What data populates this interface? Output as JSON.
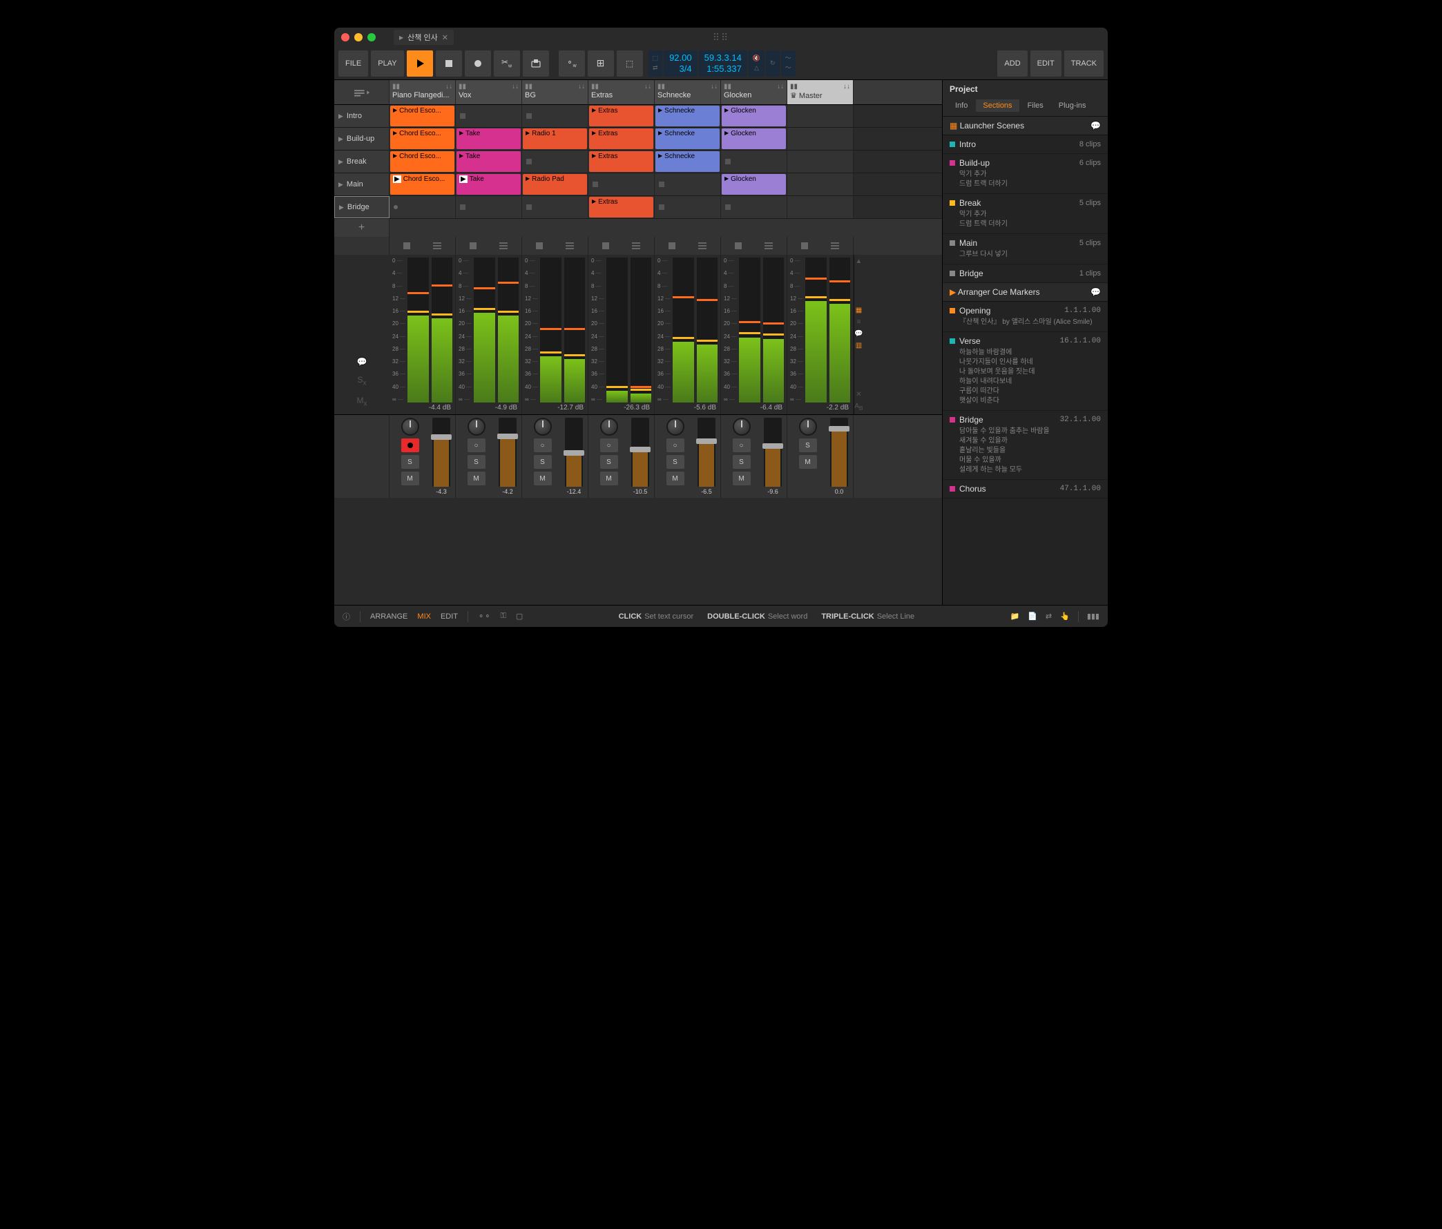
{
  "window": {
    "tab_title": "산책 인사"
  },
  "toolbar": {
    "file": "FILE",
    "play": "PLAY",
    "add": "ADD",
    "edit": "EDIT",
    "track": "TRACK",
    "tempo": "92.00",
    "timesig": "3/4",
    "position": "59.3.3.14",
    "time": "1:55.337"
  },
  "tracks": [
    {
      "name": "Piano Flangedi..."
    },
    {
      "name": "Vox"
    },
    {
      "name": "BG"
    },
    {
      "name": "Extras"
    },
    {
      "name": "Schnecke"
    },
    {
      "name": "Glocken"
    },
    {
      "name": "Master"
    }
  ],
  "scenes": [
    {
      "name": "Intro",
      "clips": [
        "Chord Esco...",
        null,
        null,
        "Extras",
        "Schnecke",
        "Glocken",
        null
      ]
    },
    {
      "name": "Build-up",
      "clips": [
        "Chord Esco...",
        "Take",
        "Radio 1",
        "Extras",
        "Schnecke",
        "Glocken",
        null
      ]
    },
    {
      "name": "Break",
      "clips": [
        "Chord Esco...",
        "Take",
        null,
        "Extras",
        "Schnecke",
        null,
        null
      ]
    },
    {
      "name": "Main",
      "clips": [
        "Chord Esco...",
        "Take",
        "Radio Pad",
        null,
        null,
        "Glocken",
        null
      ]
    },
    {
      "name": "Bridge",
      "clips": [
        null,
        null,
        null,
        "Extras",
        null,
        null,
        null
      ]
    }
  ],
  "clip_colors": {
    "Piano": "orange",
    "Vox": "magenta",
    "BG": "red",
    "Extras": "red",
    "Schnecke": "blue",
    "Glocken": "purple"
  },
  "meters": {
    "scale": [
      "0",
      "4",
      "8",
      "12",
      "16",
      "20",
      "24",
      "28",
      "32",
      "36",
      "40",
      "∞"
    ],
    "values": [
      {
        "db": "-4.4 dB",
        "l": 60,
        "r": 58,
        "pk_l": 75,
        "pk_r": 80
      },
      {
        "db": "-4.9 dB",
        "l": 62,
        "r": 60,
        "pk_l": 78,
        "pk_r": 82
      },
      {
        "db": "-12.7 dB",
        "l": 32,
        "r": 30,
        "pk_l": 50,
        "pk_r": 50
      },
      {
        "db": "-26.3 dB",
        "l": 8,
        "r": 6,
        "pk_l": 10,
        "pk_r": 10
      },
      {
        "db": "-5.6 dB",
        "l": 42,
        "r": 40,
        "pk_l": 72,
        "pk_r": 70
      },
      {
        "db": "-6.4 dB",
        "l": 45,
        "r": 44,
        "pk_l": 55,
        "pk_r": 54
      },
      {
        "db": "-2.2 dB",
        "l": 70,
        "r": 68,
        "pk_l": 85,
        "pk_r": 83
      }
    ]
  },
  "faders": [
    {
      "val": "-4.3",
      "fill": 68
    },
    {
      "val": "-4.2",
      "fill": 69
    },
    {
      "val": "-12.4",
      "fill": 45
    },
    {
      "val": "-10.5",
      "fill": 50
    },
    {
      "val": "-6.5",
      "fill": 62
    },
    {
      "val": "-9.6",
      "fill": 55
    },
    {
      "val": "0.0",
      "fill": 80
    }
  ],
  "sidebar": {
    "title": "Project",
    "tabs": [
      "Info",
      "Sections",
      "Files",
      "Plug-ins"
    ],
    "launcher_title": "Launcher Scenes",
    "cue_title": "Arranger Cue Markers",
    "scenes": [
      {
        "swatch": "#1ab5b5",
        "name": "Intro",
        "meta": "8 clips",
        "detail": ""
      },
      {
        "swatch": "#d6318f",
        "name": "Build-up",
        "meta": "6 clips",
        "detail": "악기 추가\n드럼 트랙 더하기"
      },
      {
        "swatch": "#ffb81a",
        "name": "Break",
        "meta": "5 clips",
        "detail": "악기 추가\n드럼 트랙 더하기"
      },
      {
        "swatch": "#888",
        "name": "Main",
        "meta": "5 clips",
        "detail": "그루브 다시 넣기"
      },
      {
        "swatch": "#888",
        "name": "Bridge",
        "meta": "1 clips",
        "detail": ""
      }
    ],
    "cues": [
      {
        "swatch": "#ff8c1a",
        "name": "Opening",
        "meta": "1.1.1.00",
        "detail": "『산책 인사』 by  앨리스 스마일 (Alice Smile)"
      },
      {
        "swatch": "#1ab5b5",
        "name": "Verse",
        "meta": "16.1.1.00",
        "detail": "하늘하늘 바람결에\n나뭇가지들이 인사를 하네\n나 돌아보며 웃음을 짓는데\n하늘이 내려다보네\n구름이 떠간다\n햇살이 비춘다"
      },
      {
        "swatch": "#d6318f",
        "name": "Bridge",
        "meta": "32.1.1.00",
        "detail": "담아둘 수 있을까 춤추는 바람을\n새겨둘 수 있을까\n흩날리는 빛들을\n머물 수 있을까\n설레게 하는 하늘 모두"
      },
      {
        "swatch": "#d6318f",
        "name": "Chorus",
        "meta": "47.1.1.00",
        "detail": ""
      }
    ]
  },
  "statusbar": {
    "arrange": "ARRANGE",
    "mix": "MIX",
    "edit": "EDIT",
    "h1k": "CLICK",
    "h1v": "Set text cursor",
    "h2k": "DOUBLE-CLICK",
    "h2v": "Select word",
    "h3k": "TRIPLE-CLICK",
    "h3v": "Select Line"
  }
}
